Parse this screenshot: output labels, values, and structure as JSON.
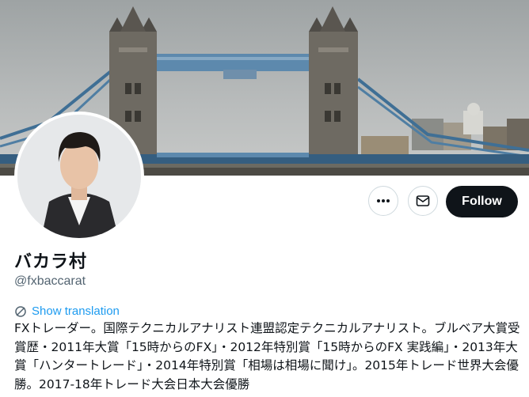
{
  "profile": {
    "display_name": "バカラ村",
    "handle": "@fxbaccarat",
    "translate_label": "Show translation",
    "bio": "FXトレーダー。国際テクニカルアナリスト連盟認定テクニカルアナリスト。ブルベア大賞受賞歴・2011年大賞「15時からのFX」・2012年特別賞「15時からのFX 実践編」・2013年大賞「ハンタートレード」・2014年特別賞「相場は相場に聞け」。2015年トレード世界大会優勝。2017-18年トレード大会日本大会優勝"
  },
  "actions": {
    "follow_label": "Follow",
    "more_icon": "more-horizontal-icon",
    "message_icon": "envelope-icon"
  },
  "colors": {
    "accent": "#1d9bf0",
    "follow_bg": "#0f1419",
    "secondary_text": "#536471"
  }
}
